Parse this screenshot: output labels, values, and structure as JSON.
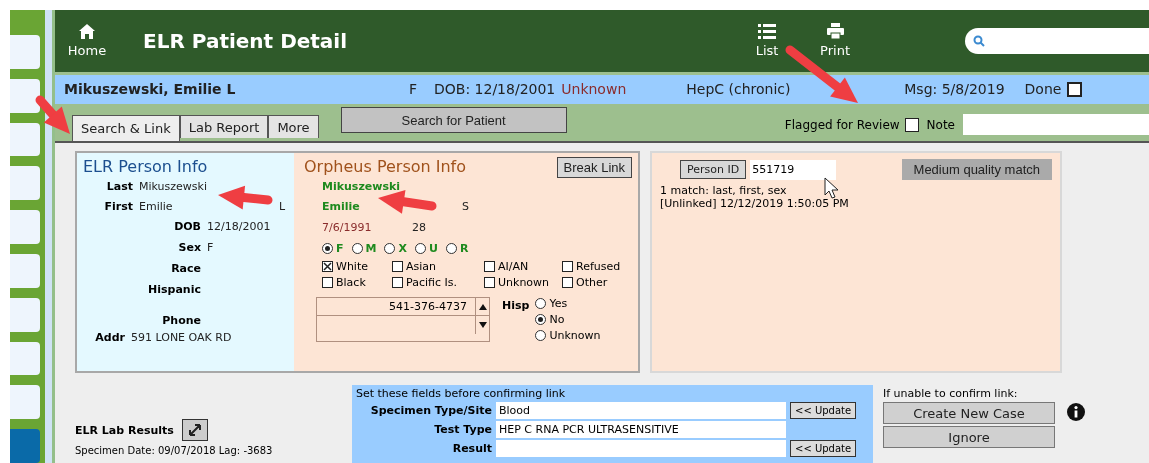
{
  "sidebar_tabs": [
    {
      "selected": false
    },
    {
      "selected": false
    },
    {
      "selected": false
    },
    {
      "selected": false
    },
    {
      "selected": false
    },
    {
      "selected": false
    },
    {
      "selected": false
    },
    {
      "selected": false
    },
    {
      "selected": false
    },
    {
      "selected": true
    }
  ],
  "header": {
    "home": "Home",
    "title": "ELR Patient Detail",
    "nav": [
      {
        "kind": "list",
        "label": "List"
      },
      {
        "kind": "print",
        "label": "Print"
      }
    ]
  },
  "patient_bar": {
    "name": "Mikuszewski, Emilie L",
    "sex": "F",
    "dob": "DOB: 12/18/2001",
    "dob_status": "Unknown",
    "condition": "HepC (chronic)",
    "msg": "Msg: 5/8/2019",
    "done": {
      "label": "Done",
      "checked": false
    }
  },
  "tabs": [
    {
      "label": "Search & Link",
      "selected": true
    },
    {
      "label": "Lab Report",
      "selected": false
    },
    {
      "label": "More",
      "selected": false
    }
  ],
  "search_button": "Search for Patient",
  "flagged": {
    "label": "Flagged for Review",
    "checked": false
  },
  "note_label": "Note",
  "elr_person": {
    "title": "ELR Person Info",
    "last_label": "Last",
    "last": "Mikuszewski",
    "first_label": "First",
    "first": "Emilie",
    "middle": "L",
    "fields": [
      {
        "label": "DOB",
        "value": "12/18/2001"
      },
      {
        "label": "Sex",
        "value": "F"
      },
      {
        "label": "Race"
      },
      {
        "label": "Hispanic"
      },
      {
        "label": "Phone"
      }
    ],
    "addr_label": "Addr",
    "addr": "591 LONE OAK RD"
  },
  "orpheus_person": {
    "title": "Orpheus Person Info",
    "break_link": "Break Link",
    "last": "Mikuszewski",
    "first": "Emilie",
    "middle": "S",
    "dob": "7/6/1991",
    "age": "28",
    "sex_options": [
      {
        "label": "F",
        "selected": true
      },
      {
        "label": "M",
        "selected": false
      },
      {
        "label": "X",
        "selected": false
      },
      {
        "label": "U",
        "selected": false
      },
      {
        "label": "R",
        "selected": false
      }
    ],
    "race_options": [
      {
        "label": "White",
        "checked": true
      },
      {
        "label": "Asian",
        "checked": false
      },
      {
        "label": "AI/AN",
        "checked": false
      },
      {
        "label": "Refused",
        "checked": false
      },
      {
        "label": "Black",
        "checked": false
      },
      {
        "label": "Pacific Is.",
        "checked": false
      },
      {
        "label": "Unknown",
        "checked": false
      },
      {
        "label": "Other",
        "checked": false
      }
    ],
    "phone": "541-376-4737",
    "hisp_label": "Hisp",
    "hisp_options": [
      {
        "label": "Yes",
        "selected": false
      },
      {
        "label": "No",
        "selected": true
      },
      {
        "label": "Unknown",
        "selected": false
      }
    ]
  },
  "match": {
    "person_id_button": "Person ID",
    "person_id": "551719",
    "quality": "Medium quality match",
    "lines": [
      "1 match: last, first, sex",
      "[Unlinked] 12/12/2019 1:50:05 PM"
    ]
  },
  "lab_results": {
    "title": "ELR Lab Results",
    "specimen": "Specimen Date: 09/07/2018  Lag: -3683"
  },
  "confirm": {
    "title": "Set these fields before confirming link",
    "fields": [
      {
        "label": "Specimen Type/Site",
        "value": "Blood",
        "update": "<< Update"
      },
      {
        "label": "Test Type",
        "value": "HEP C RNA PCR ULTRASENSITIVE"
      },
      {
        "label": "Result",
        "update": "<< Update"
      }
    ]
  },
  "unable": {
    "label": "If unable to confirm link:",
    "buttons": [
      "Create New Case",
      "Ignore"
    ]
  }
}
